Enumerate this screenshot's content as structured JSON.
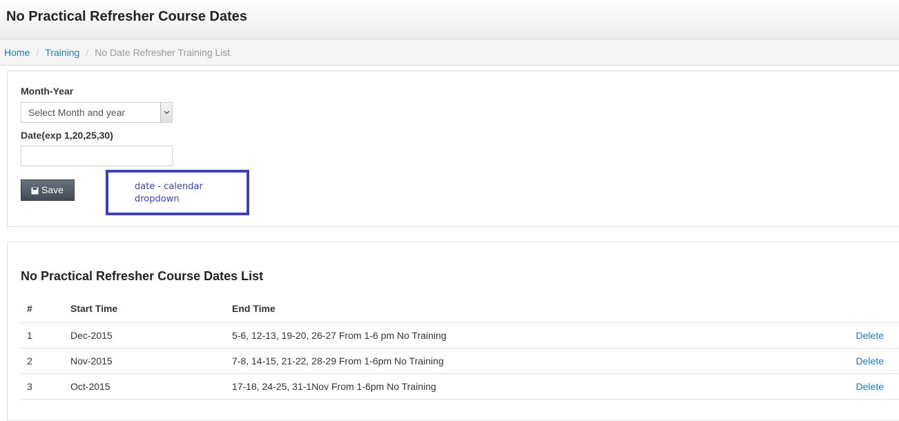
{
  "header": {
    "title": "No Practical Refresher Course Dates"
  },
  "breadcrumb": {
    "home": "Home",
    "training": "Training",
    "current": "No Date Refresher Training List"
  },
  "form": {
    "month_year_label": "Month-Year",
    "month_year_selected": "Select Month and year",
    "date_label": "Date(exp 1,20,25,30)",
    "date_value": "",
    "save_label": "Save",
    "annotation": "date - calendar dropdown"
  },
  "list": {
    "title": "No Practical Refresher Course Dates List",
    "columns": [
      "#",
      "Start Time",
      "End Time",
      ""
    ],
    "rows": [
      {
        "num": "1",
        "start": "Dec-2015",
        "end": "5-6, 12-13, 19-20, 26-27 From 1-6 pm No Training",
        "action": "Delete"
      },
      {
        "num": "2",
        "start": "Nov-2015",
        "end": "7-8, 14-15, 21-22, 28-29 From 1-6pm No Training",
        "action": "Delete"
      },
      {
        "num": "3",
        "start": "Oct-2015",
        "end": "17-18, 24-25, 31-1Nov From 1-6pm No Training",
        "action": "Delete"
      }
    ]
  },
  "colors": {
    "link": "#1a7bbf",
    "annotation": "#3d3fc0",
    "button": "#4f5761"
  },
  "icons": {
    "save": "floppy-disk-icon",
    "dropdown": "chevron-down-icon"
  }
}
